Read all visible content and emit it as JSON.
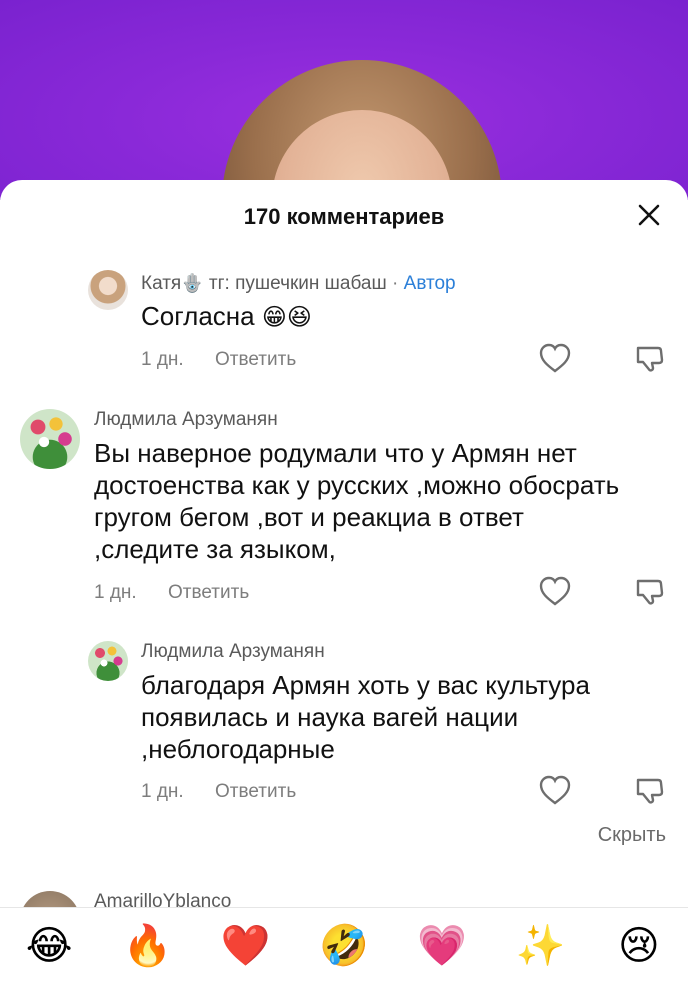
{
  "sheet": {
    "title": "170 комментариев"
  },
  "comments": [
    {
      "author": "Катя",
      "author_emoji": "🪬",
      "author_extra": "тг: пушечкин шабаш",
      "separator": "·",
      "badge": "Автор",
      "text": "Согласна",
      "text_emoji": "😁😆",
      "time": "1 дн.",
      "reply_label": "Ответить"
    },
    {
      "author": "Людмила Арзуманян",
      "text": "Вы наверное родумали что у Армян нет достоенства как у русских ,можно обосрать гругом бегом ,вот и реакциа в ответ ,следите за языком,",
      "time": "1 дн.",
      "reply_label": "Ответить"
    },
    {
      "author": "Людмила Арзуманян",
      "text": "благодаря Армян хоть у вас культура появилась и наука вагей нации ,неблогодарные",
      "time": "1 дн.",
      "reply_label": "Ответить"
    },
    {
      "author": "AmarilloYblanco"
    }
  ],
  "hide_label": "Скрыть",
  "emoji_bar": [
    "😂",
    "🔥",
    "❤️",
    "🤣",
    "💗",
    "✨",
    "😢"
  ],
  "colors": {
    "video_bg": "#8a29d8",
    "badge": "#2b7fd8",
    "text": "#111111",
    "meta": "#7d7d7d"
  }
}
